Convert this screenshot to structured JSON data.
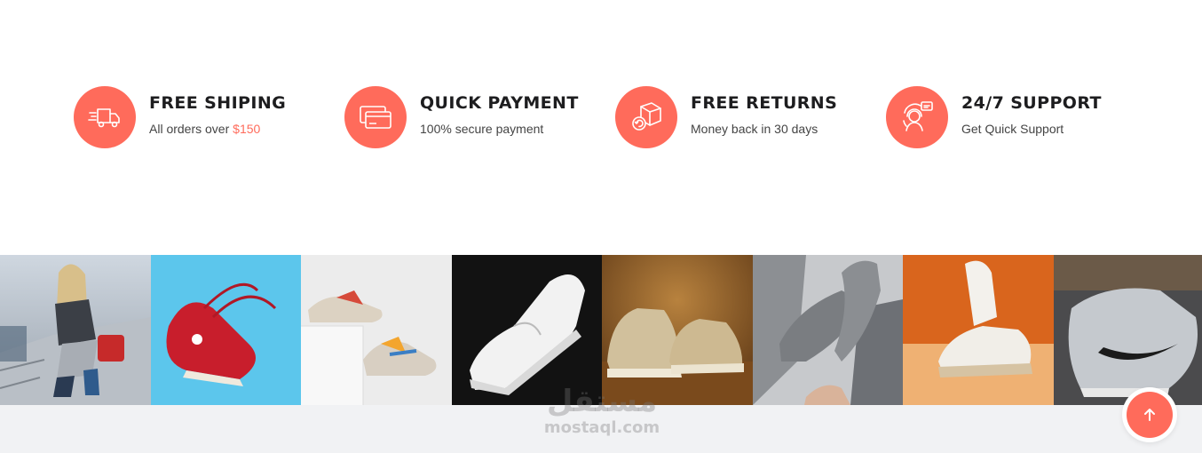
{
  "theme": {
    "accent": "#ff6b5b",
    "band_background": "#f1f2f4"
  },
  "features": [
    {
      "icon": "delivery-truck-icon",
      "title": "FREE SHIPING",
      "desc_prefix": "All orders over ",
      "desc_highlight": "$150"
    },
    {
      "icon": "credit-card-icon",
      "title": "QUICK PAYMENT",
      "desc_prefix": "100% secure payment",
      "desc_highlight": ""
    },
    {
      "icon": "return-box-icon",
      "title": "FREE RETURNS",
      "desc_prefix": "Money back in 30 days",
      "desc_highlight": ""
    },
    {
      "icon": "support-agent-icon",
      "title": "24/7 SUPPORT",
      "desc_prefix": "Get Quick Support",
      "desc_highlight": ""
    }
  ],
  "gallery": [
    {
      "alt": "Woman sitting on stairs wearing sneakers"
    },
    {
      "alt": "Red high-top sneaker on blue background"
    },
    {
      "alt": "Colorful sneakers on white blocks"
    },
    {
      "alt": "White Puma sneaker on black background"
    },
    {
      "alt": "Beige Converse sneakers on wooden floor"
    },
    {
      "alt": "Grey knit sneakers floating above hand"
    },
    {
      "alt": "White sneaker on orange background"
    },
    {
      "alt": "Grey Nike sneaker close-up"
    }
  ],
  "watermark": {
    "arabic": "مستقل",
    "latin": "mostaql.com"
  },
  "scroll_top": {
    "icon": "arrow-up-icon"
  }
}
